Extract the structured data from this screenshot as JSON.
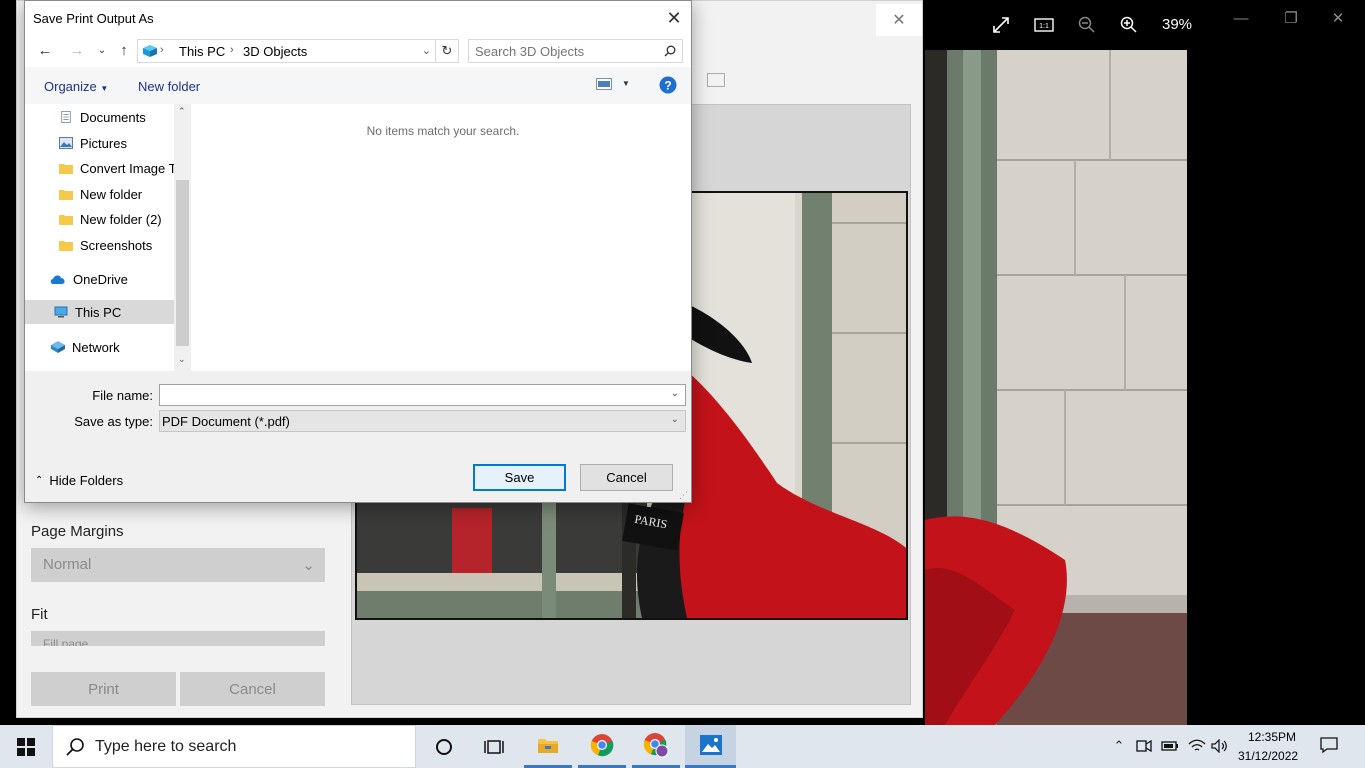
{
  "photos_app": {
    "zoom_level": "39%"
  },
  "print_dialog": {
    "page_margins_label": "Page Margins",
    "page_margins_value": "Normal",
    "fit_label": "Fit",
    "fit_value": "Fill page",
    "print_label": "Print",
    "cancel_label": "Cancel"
  },
  "save_dialog": {
    "title": "Save Print Output As",
    "address": {
      "segments": [
        "This PC",
        "3D Objects"
      ]
    },
    "search_placeholder": "Search 3D Objects",
    "toolbar": {
      "organize": "Organize",
      "new_folder": "New folder"
    },
    "tree": [
      {
        "label": "Documents",
        "icon": "documents-icon",
        "pinned": true
      },
      {
        "label": "Pictures",
        "icon": "pictures-icon",
        "pinned": true
      },
      {
        "label": "Convert Image T",
        "icon": "folder-icon",
        "pinned": false
      },
      {
        "label": "New folder",
        "icon": "folder-icon",
        "pinned": false
      },
      {
        "label": "New folder (2)",
        "icon": "folder-icon",
        "pinned": false
      },
      {
        "label": "Screenshots",
        "icon": "folder-icon",
        "pinned": false
      },
      {
        "label": "OneDrive",
        "icon": "onedrive-icon",
        "pinned": false
      },
      {
        "label": "This PC",
        "icon": "this-pc-icon",
        "pinned": false,
        "selected": true
      },
      {
        "label": "Network",
        "icon": "network-icon",
        "pinned": false
      }
    ],
    "empty_message": "No items match your search.",
    "file_name_label": "File name:",
    "file_name_value": "",
    "save_as_type_label": "Save as type:",
    "save_as_type_value": "PDF Document (*.pdf)",
    "hide_folders": "Hide Folders",
    "save_button": "Save",
    "cancel_button": "Cancel"
  },
  "taskbar": {
    "search_placeholder": "Type here to search",
    "time": "12:35PM",
    "date": "31/12/2022"
  },
  "colors": {
    "accent": "#0078d7",
    "link_text": "#1e3287",
    "taskbar_bg": "#dfe6ee"
  }
}
